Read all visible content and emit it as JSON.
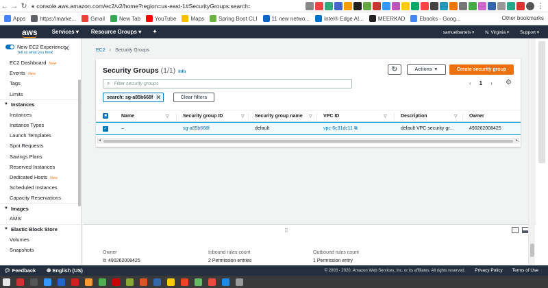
{
  "browser": {
    "url": "console.aws.amazon.com/ec2/v2/home?region=us-east-1#SecurityGroups:search=sg-a85...",
    "bookmarks": [
      {
        "label": "Apps",
        "color": "#4285f4"
      },
      {
        "label": "https://marke...",
        "color": "#5f6368"
      },
      {
        "label": "Gmail",
        "color": "#ea4335"
      },
      {
        "label": "New Tab",
        "color": "#34a853"
      },
      {
        "label": "YouTube",
        "color": "#ff0000"
      },
      {
        "label": "Maps",
        "color": "#fbbc04"
      },
      {
        "label": "Spring Boot CLI",
        "color": "#6db33f"
      },
      {
        "label": "11 new netwo...",
        "color": "#0a66c2"
      },
      {
        "label": "Intel® Edge AI...",
        "color": "#0071c5"
      },
      {
        "label": "MEERKAD",
        "color": "#222222"
      },
      {
        "label": "Ebooks - Goog...",
        "color": "#4285f4"
      }
    ],
    "other_bookmarks": "Other bookmarks"
  },
  "aws_nav": {
    "logo": "aws",
    "services": "Services ▾",
    "resource_groups": "Resource Groups ▾",
    "user": "samuelbartels ▾",
    "region": "N. Virginia ▾",
    "support": "Support ▾"
  },
  "sidebar": {
    "toggle_title": "New EC2 Experience",
    "toggle_sub": "Tell us what you think",
    "top_items": [
      {
        "label": "EC2 Dashboard",
        "new": "New"
      },
      {
        "label": "Events",
        "new": "New"
      },
      {
        "label": "Tags",
        "new": ""
      },
      {
        "label": "Limits",
        "new": ""
      }
    ],
    "instances_header": "Instances",
    "instances_items": [
      {
        "label": "Instances",
        "new": ""
      },
      {
        "label": "Instance Types",
        "new": ""
      },
      {
        "label": "Launch Templates",
        "new": ""
      },
      {
        "label": "Spot Requests",
        "new": ""
      },
      {
        "label": "Savings Plans",
        "new": ""
      },
      {
        "label": "Reserved Instances",
        "new": ""
      },
      {
        "label": "Dedicated Hosts",
        "new": "New"
      },
      {
        "label": "Scheduled Instances",
        "new": ""
      },
      {
        "label": "Capacity Reservations",
        "new": ""
      }
    ],
    "images_header": "Images",
    "images_items": [
      {
        "label": "AMIs"
      }
    ],
    "ebs_header": "Elastic Block Store",
    "ebs_items": [
      {
        "label": "Volumes"
      },
      {
        "label": "Snapshots"
      }
    ]
  },
  "breadcrumb": {
    "root": "EC2",
    "sep": "›",
    "current": "Security Groups"
  },
  "panel": {
    "title": "Security Groups",
    "count": "(1/1)",
    "info": "Info",
    "actions": "Actions ▼",
    "create": "Create security group",
    "filter_placeholder": "Filter security groups",
    "page": "1",
    "token": "search: sg-a85b668f",
    "clear": "Clear filters"
  },
  "table": {
    "columns": [
      "Name",
      "Security group ID",
      "Security group name",
      "VPC ID",
      "Description",
      "Owner"
    ],
    "rows": [
      {
        "name": "–",
        "sg_id": "sg-a85b668f",
        "sg_name": "default",
        "vpc_id": "vpc-6c31dc11",
        "description": "default VPC security gr...",
        "owner": "490262008425"
      }
    ]
  },
  "details": {
    "owner_label": "Owner",
    "owner_value": "490262008425",
    "inbound_label": "Inbound rules count",
    "inbound_value": "2 Permission entries",
    "outbound_label": "Outbound rules count",
    "outbound_value": "1 Permission entry"
  },
  "footer": {
    "feedback": "Feedback",
    "language": "English (US)",
    "copyright": "© 2008 - 2020, Amazon Web Services, Inc. or its affiliates. All rights reserved.",
    "privacy": "Privacy Policy",
    "terms": "Terms of Use"
  },
  "taskbar_colors": [
    "#e8e8e8",
    "#cc3333",
    "#555555",
    "#3399ff",
    "#2266cc",
    "#cc2222",
    "#ff9933",
    "#4caf50",
    "#cc0000",
    "#88aa33",
    "#dd5522",
    "#3366aa",
    "#ffcc00",
    "#ee4422",
    "#66bb66",
    "#e84c3d",
    "#1e88e5",
    "#999999"
  ]
}
